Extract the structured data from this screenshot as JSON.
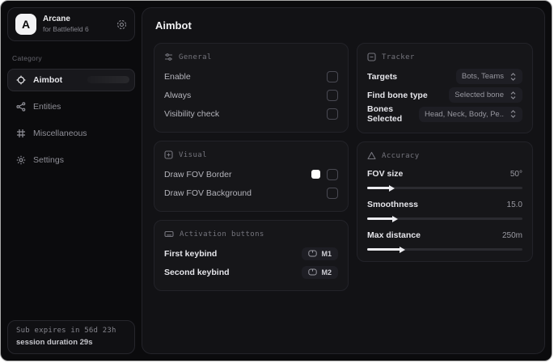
{
  "colors": {
    "fov_border_swatch": "#ffffff",
    "slider_fill": "#ececf0",
    "card_background": "#161619",
    "panel_background": "#121215"
  },
  "sidebar": {
    "app_name": "Arcane",
    "app_subtitle": "for Battlefield 6",
    "logo_letter": "A",
    "category_label": "Category",
    "items": [
      {
        "label": "Aimbot",
        "icon": "crosshair-icon",
        "active": true
      },
      {
        "label": "Entities",
        "icon": "entities-icon",
        "active": false
      },
      {
        "label": "Miscellaneous",
        "icon": "grid-icon",
        "active": false
      },
      {
        "label": "Settings",
        "icon": "gear-icon",
        "active": false
      }
    ],
    "footer": {
      "sub_expires": "Sub expires in 56d 23h",
      "session_duration": "session duration 29s"
    }
  },
  "main": {
    "page_title": "Aimbot",
    "general": {
      "header": "General",
      "rows": [
        {
          "label": "Enable",
          "checked": false
        },
        {
          "label": "Always",
          "checked": false
        },
        {
          "label": "Visibility check",
          "checked": false
        }
      ]
    },
    "visual": {
      "header": "Visual",
      "rows": [
        {
          "label": "Draw FOV Border",
          "swatch": "#ffffff",
          "checked": false
        },
        {
          "label": "Draw FOV Background",
          "checked": false
        }
      ]
    },
    "activation": {
      "header": "Activation buttons",
      "rows": [
        {
          "label": "First keybind",
          "key": "M1"
        },
        {
          "label": "Second keybind",
          "key": "M2"
        }
      ]
    },
    "tracker": {
      "header": "Tracker",
      "rows": [
        {
          "label": "Targets",
          "value": "Bots, Teams"
        },
        {
          "label": "Find bone type",
          "value": "Selected bone"
        },
        {
          "label": "Bones Selected",
          "value": "Head, Neck, Body, Pe.."
        }
      ]
    },
    "accuracy": {
      "header": "Accuracy",
      "rows": [
        {
          "label": "FOV size",
          "value": "50°",
          "percent": 15
        },
        {
          "label": "Smoothness",
          "value": "15.0",
          "percent": 17
        },
        {
          "label": "Max distance",
          "value": "250m",
          "percent": 22
        }
      ]
    }
  }
}
